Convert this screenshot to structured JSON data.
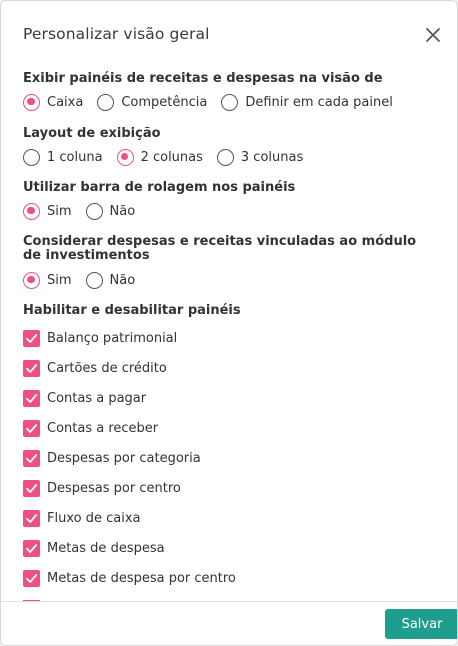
{
  "dialog": {
    "title": "Personalizar visão geral",
    "close_icon": "close-icon",
    "save_label": "Salvar"
  },
  "colors": {
    "accent": "#f04e84",
    "primary_button": "#1f9e8d"
  },
  "sections": {
    "regime": {
      "title": "Exibir painéis de receitas e despesas na visão de",
      "options": [
        "Caixa",
        "Competência",
        "Definir em cada painel"
      ],
      "selected": "Caixa"
    },
    "layout": {
      "title": "Layout de exibição",
      "options": [
        "1 coluna",
        "2 colunas",
        "3 colunas"
      ],
      "selected": "2 colunas"
    },
    "scroll": {
      "title": "Utilizar barra de rolagem nos painéis",
      "options": [
        "Sim",
        "Não"
      ],
      "selected": "Sim"
    },
    "investments": {
      "title": "Considerar despesas e receitas vinculadas ao módulo de investimentos",
      "options": [
        "Sim",
        "Não"
      ],
      "selected": "Sim"
    },
    "panels": {
      "title": "Habilitar e desabilitar painéis",
      "items": [
        {
          "label": "Balanço patrimonial",
          "checked": true
        },
        {
          "label": "Cartões de crédito",
          "checked": true
        },
        {
          "label": "Contas a pagar",
          "checked": true
        },
        {
          "label": "Contas a receber",
          "checked": true
        },
        {
          "label": "Despesas por categoria",
          "checked": true
        },
        {
          "label": "Despesas por centro",
          "checked": true
        },
        {
          "label": "Fluxo de caixa",
          "checked": true
        },
        {
          "label": "Metas de despesa",
          "checked": true
        },
        {
          "label": "Metas de despesa por centro",
          "checked": true
        }
      ]
    }
  }
}
